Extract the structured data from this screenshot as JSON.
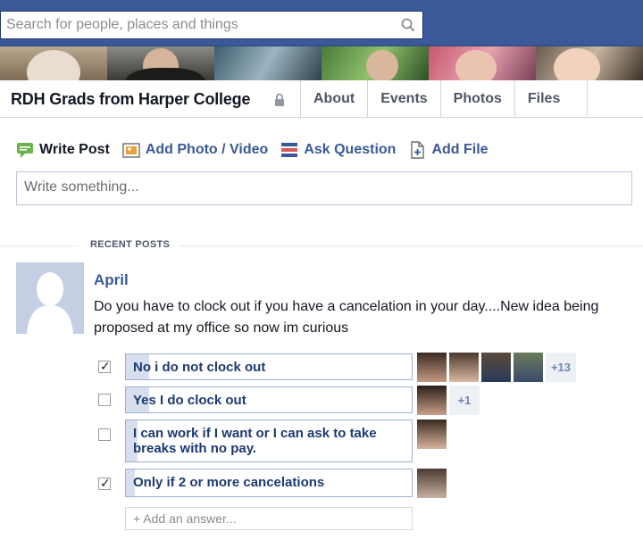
{
  "search": {
    "placeholder": "Search for people, places and things"
  },
  "group": {
    "name": "RDH Grads from Harper College",
    "tabs": [
      "About",
      "Events",
      "Photos",
      "Files"
    ]
  },
  "composer": {
    "actions": [
      {
        "label": "Write Post",
        "icon": "speech-bubble-icon"
      },
      {
        "label": "Add Photo / Video",
        "icon": "photo-icon"
      },
      {
        "label": "Ask Question",
        "icon": "question-list-icon"
      },
      {
        "label": "Add File",
        "icon": "file-icon"
      }
    ],
    "placeholder": "Write something..."
  },
  "recent_posts_label": "RECENT POSTS",
  "post": {
    "author": "April",
    "text": "Do you have to clock out if you have a cancelation in your day....New idea being proposed at my office so now im curious",
    "poll": [
      {
        "label": "No i do not clock out",
        "checked": true,
        "fill": 0.08,
        "voters": 4,
        "more": "+13"
      },
      {
        "label": "Yes I do clock out",
        "checked": false,
        "fill": 0.08,
        "voters": 1,
        "more": "+1"
      },
      {
        "label": "I can work if I want or I can ask to take breaks with no pay.",
        "checked": false,
        "fill": 0.04,
        "voters": 1,
        "more": ""
      },
      {
        "label": "Only if 2 or more cancelations",
        "checked": true,
        "fill": 0.03,
        "voters": 1,
        "more": ""
      }
    ],
    "add_answer_placeholder": "+ Add an answer..."
  },
  "colors": {
    "brand": "#3b5998",
    "poll_fill": "#d7dfee"
  }
}
